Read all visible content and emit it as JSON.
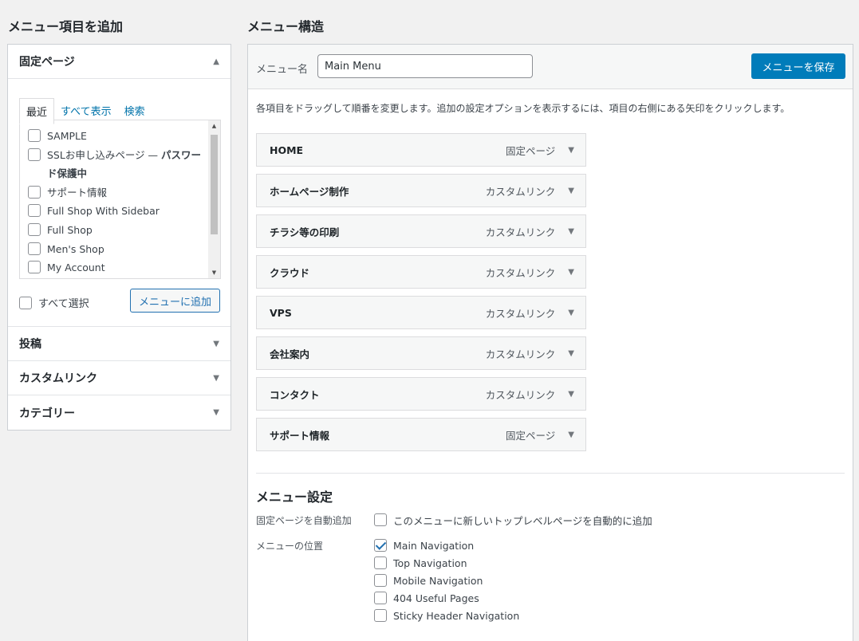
{
  "left": {
    "heading": "メニュー項目を追加",
    "pages_panel": {
      "title": "固定ページ",
      "tabs": [
        "最近",
        "すべて表示",
        "検索"
      ],
      "items": [
        {
          "label": "SAMPLE"
        },
        {
          "label": "SSLお申し込みページ — ",
          "bold": "パスワード保護中"
        },
        {
          "label": "サポート情報"
        },
        {
          "label": "Full Shop With Sidebar"
        },
        {
          "label": "Full Shop"
        },
        {
          "label": "Men's Shop"
        },
        {
          "label": "My Account"
        }
      ],
      "select_all": "すべて選択",
      "add_button": "メニューに追加"
    },
    "sections": [
      "投稿",
      "カスタムリンク",
      "カテゴリー"
    ]
  },
  "right": {
    "heading": "メニュー構造",
    "menu_name_label": "メニュー名",
    "menu_name_value": "Main Menu",
    "save_button": "メニューを保存",
    "instructions": "各項目をドラッグして順番を変更します。追加の設定オプションを表示するには、項目の右側にある矢印をクリックします。",
    "menu_items": [
      {
        "name": "HOME",
        "type": "固定ページ"
      },
      {
        "name": "ホームページ制作",
        "type": "カスタムリンク"
      },
      {
        "name": "チラシ等の印刷",
        "type": "カスタムリンク"
      },
      {
        "name": "クラウド",
        "type": "カスタムリンク"
      },
      {
        "name": "VPS",
        "type": "カスタムリンク"
      },
      {
        "name": "会社案内",
        "type": "カスタムリンク"
      },
      {
        "name": "コンタクト",
        "type": "カスタムリンク"
      },
      {
        "name": "サポート情報",
        "type": "固定ページ"
      }
    ],
    "settings": {
      "heading": "メニュー設定",
      "auto_add_label": "固定ページを自動追加",
      "auto_add_option": "このメニューに新しいトップレベルページを自動的に追加",
      "location_label": "メニューの位置",
      "locations": [
        {
          "label": "Main Navigation",
          "checked": true
        },
        {
          "label": "Top Navigation",
          "checked": false
        },
        {
          "label": "Mobile Navigation",
          "checked": false
        },
        {
          "label": "404 Useful Pages",
          "checked": false
        },
        {
          "label": "Sticky Header Navigation",
          "checked": false
        }
      ]
    }
  },
  "colors": {
    "primary": "#007cba",
    "link": "#0073aa",
    "border": "#ccd0d4",
    "background": "#f1f1f1"
  }
}
